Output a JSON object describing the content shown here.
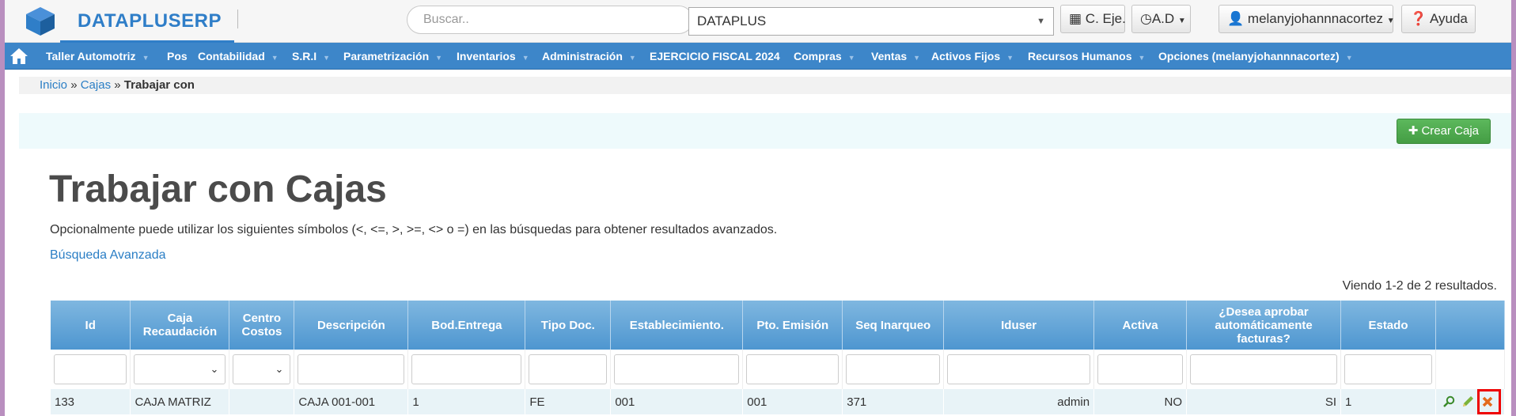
{
  "header": {
    "brand": "DATAPLUSERP",
    "search_placeholder": "Buscar..",
    "company_value": "DATAPLUS",
    "btn_cal": "C. Eje.",
    "btn_ad": "A.D",
    "btn_user": "melanyjohannnacortez",
    "btn_help": "Ayuda"
  },
  "nav": [
    "Taller Automotriz",
    "Pos",
    "Contabilidad",
    "S.R.I",
    "Parametrización",
    "Inventarios",
    "Administración",
    "EJERCICIO FISCAL 2024",
    "Compras",
    "Ventas",
    "Activos Fijos",
    "Recursos Humanos",
    "Opciones (melanyjohannnacortez)"
  ],
  "breadcrumb": {
    "home": "Inicio",
    "sep": "»",
    "parent": "Cajas",
    "current": "Trabajar con"
  },
  "create_button": "Crear Caja",
  "title": "Trabajar con Cajas",
  "hint": "Opcionalmente puede utilizar los siguientes símbolos (<, <=, >, >=, <> o =) en las búsquedas para obtener resultados avanzados.",
  "advanced_search": "Búsqueda Avanzada",
  "results_text": "Viendo 1-2 de 2 resultados.",
  "columns": [
    "Id",
    "Caja Recaudación",
    "Centro Costos",
    "Descripción",
    "Bod.Entrega",
    "Tipo Doc.",
    "Establecimiento.",
    "Pto. Emisión",
    "Seq Inarqueo",
    "Iduser",
    "Activa",
    "¿Desea aprobar automáticamente facturas?",
    "Estado"
  ],
  "rows": [
    [
      "133",
      "CAJA MATRIZ",
      "",
      "CAJA 001-001",
      "1",
      "FE",
      "001",
      "001",
      "371",
      "admin",
      "NO",
      "SI",
      "1"
    ]
  ],
  "colors": {
    "nav": "#3d86c9",
    "header_blue": "#4e96d0",
    "create": "#5cb85c",
    "highlight": "#ee0000"
  }
}
